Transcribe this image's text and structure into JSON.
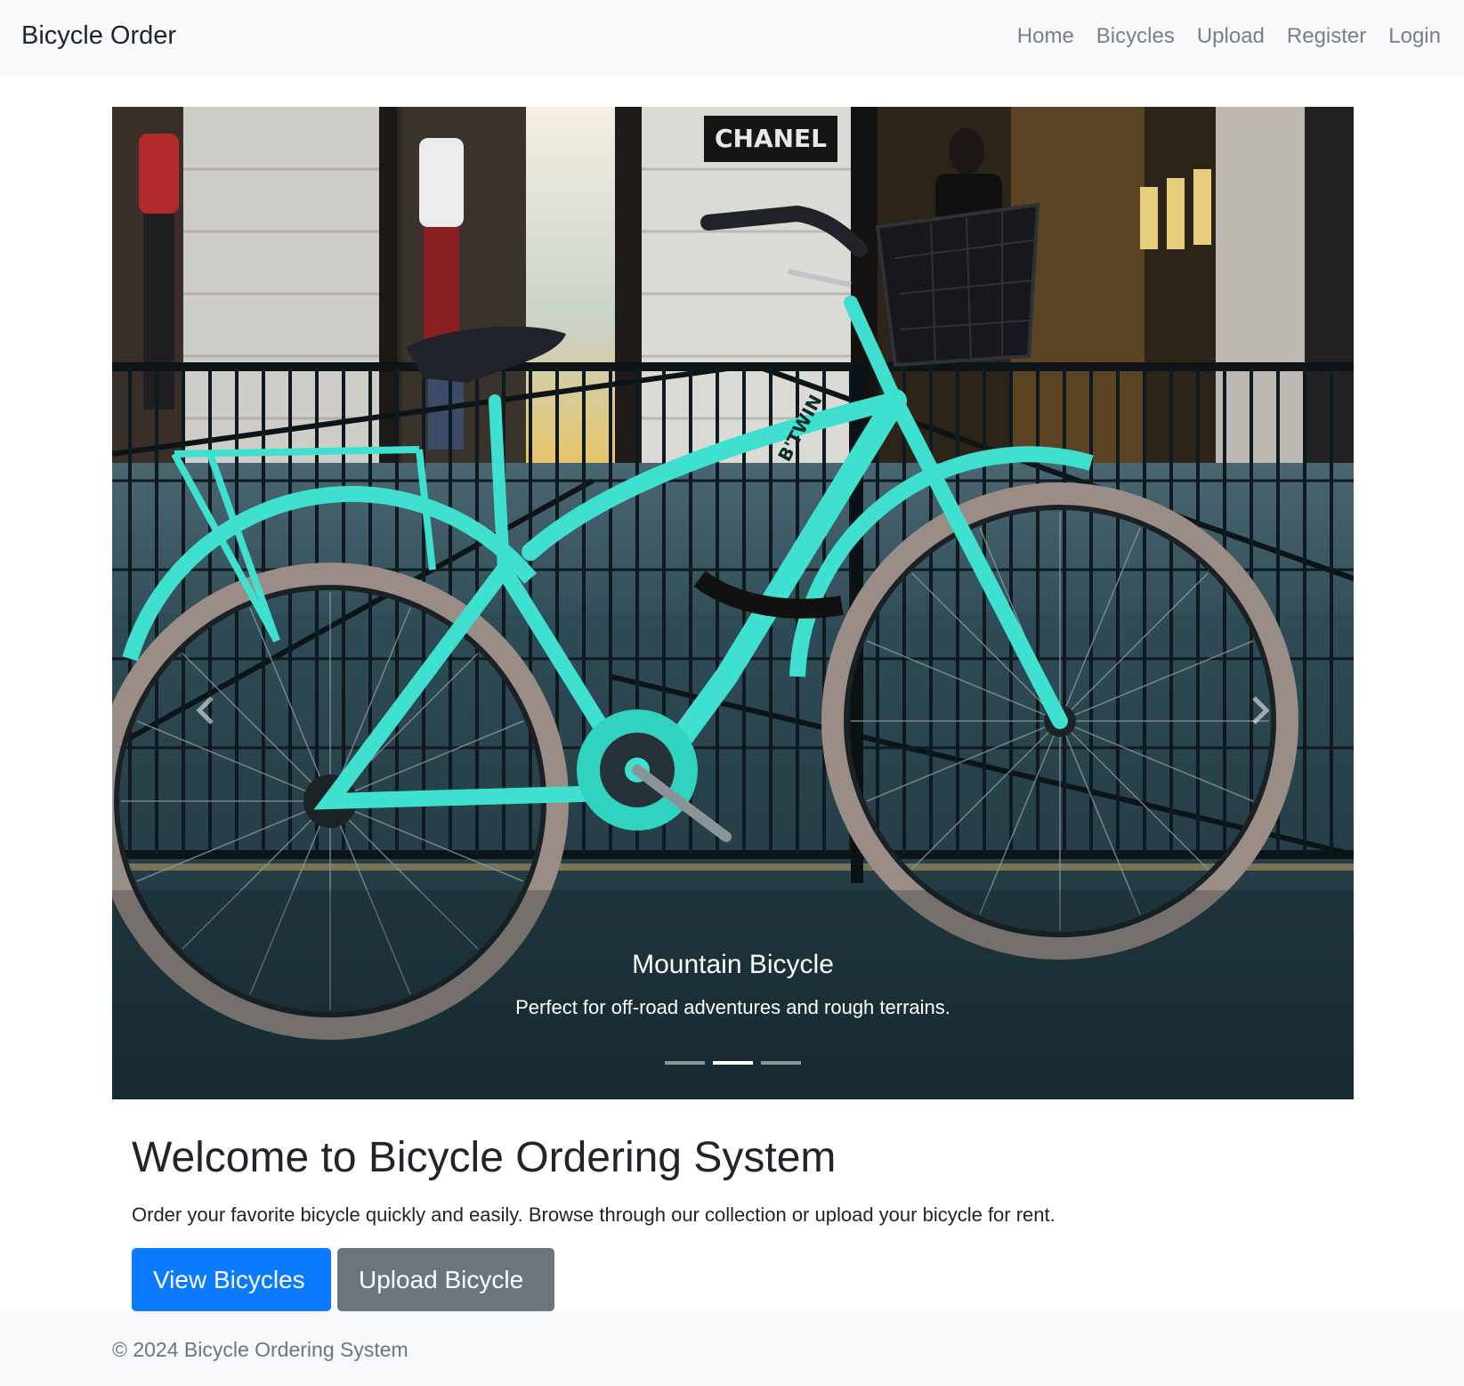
{
  "navbar": {
    "brand": "Bicycle Order",
    "links": [
      "Home",
      "Bicycles",
      "Upload",
      "Register",
      "Login"
    ]
  },
  "carousel": {
    "caption_title": "Mountain Bicycle",
    "caption_text": "Perfect for off-road adventures and rough terrains.",
    "store_sign": "CHANEL",
    "bike_brand": "B'TWIN",
    "slide_count": 3,
    "active_slide": 2
  },
  "welcome": {
    "title": "Welcome to Bicycle Ordering System",
    "text": "Order your favorite bicycle quickly and easily. Browse through our collection or upload your bicycle for rent."
  },
  "buttons": {
    "view": "View Bicycles",
    "upload": "Upload Bicycle"
  },
  "footer": {
    "text": "© 2024 Bicycle Ordering System"
  },
  "colors": {
    "navbar_bg": "#f8f9fa",
    "primary": "#0a7bff",
    "secondary": "#6c757d",
    "bike_frame": "#3fe0cf"
  }
}
